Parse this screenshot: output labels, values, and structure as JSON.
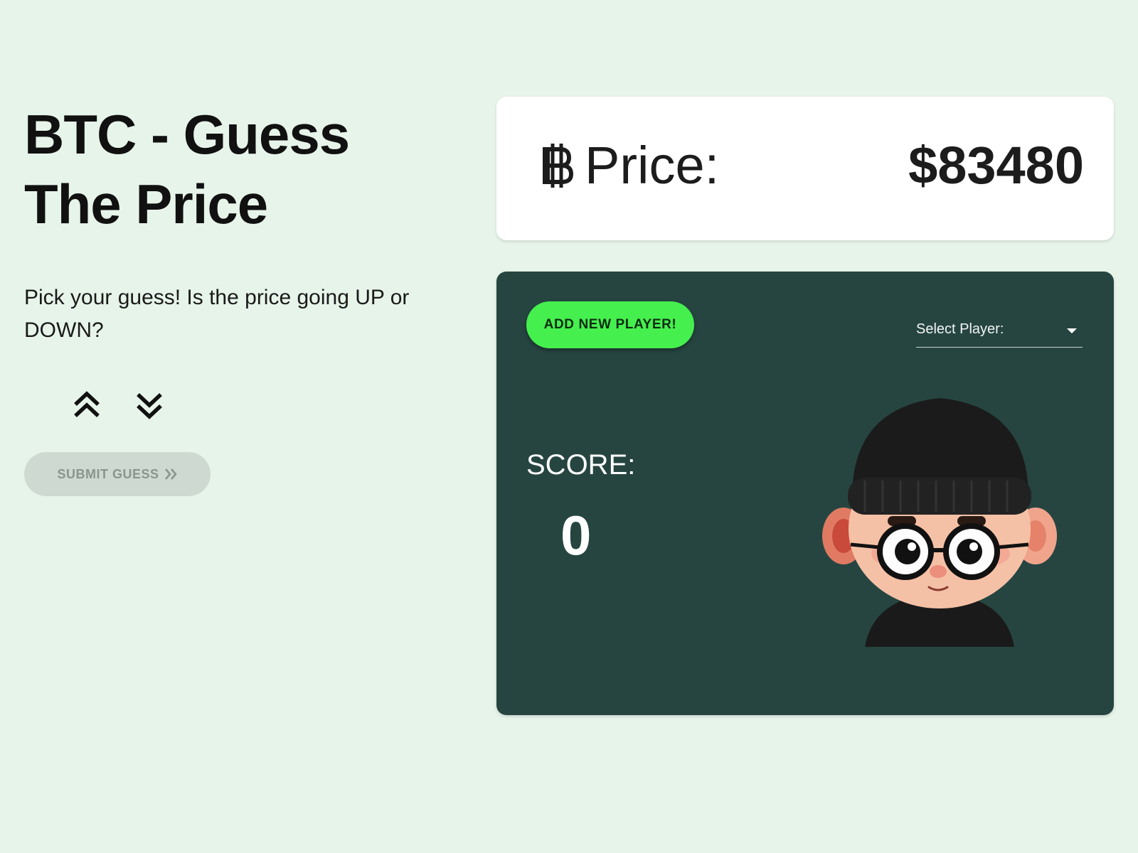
{
  "header": {
    "title_line1": "BTC - Guess",
    "title_line2": "The Price"
  },
  "instructions": {
    "text": "Pick your guess! Is the price going UP or DOWN?"
  },
  "guess_controls": {
    "up_icon": "double-chevron-up-icon",
    "down_icon": "double-chevron-down-icon",
    "submit_label": "SUBMIT GUESS",
    "submit_icon": "double-chevron-right-icon"
  },
  "price_card": {
    "currency_icon": "bitcoin-icon",
    "label": "Price:",
    "value": "$83480"
  },
  "game_panel": {
    "add_player_label": "ADD NEW PLAYER!",
    "select_player_label": "Select Player:",
    "select_icon": "caret-down-icon",
    "score_label": "SCORE:",
    "score_value": "0",
    "avatar_icon": "player-avatar"
  },
  "colors": {
    "background": "#e7f4ea",
    "panel": "#264541",
    "accent_green": "#45f04e",
    "disabled_button": "#cdd9d1",
    "card": "#ffffff"
  }
}
